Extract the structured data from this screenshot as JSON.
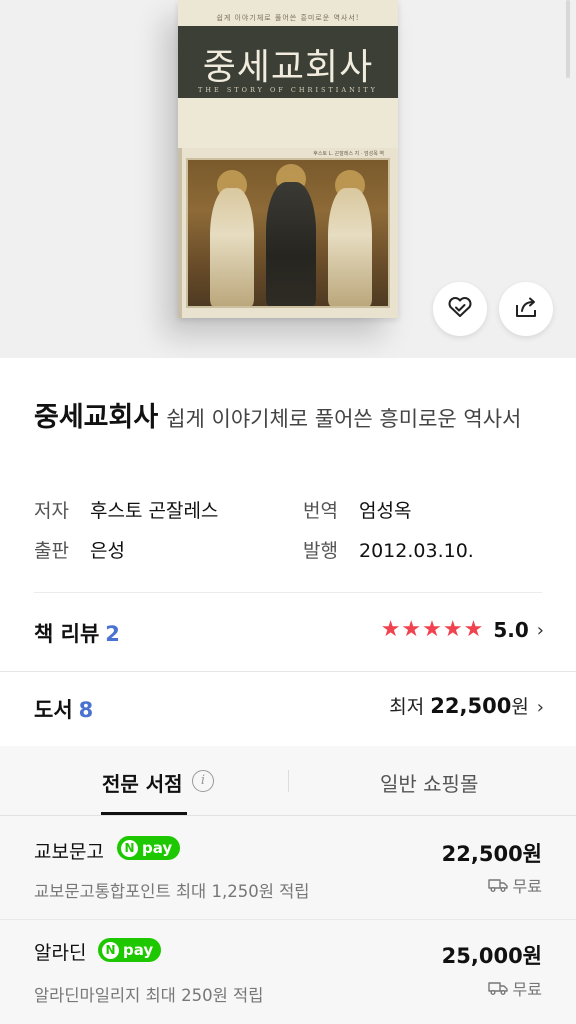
{
  "book_cover": {
    "title": "중세교회사",
    "subtitle_line": "쉽게 이야기체로 풀어쓴 흥미로운 역사서!",
    "english_title": "THE STORY OF CHRISTIANITY",
    "author_line": "후스토 L. 곤잘레스 지 · 엄성옥 역"
  },
  "actions": {
    "like_icon": "heart-check-icon",
    "share_icon": "share-icon"
  },
  "book": {
    "title": "중세교회사",
    "subtitle": "쉽게 이야기체로 풀어쓴 흥미로운 역사서"
  },
  "meta": {
    "author_label": "저자",
    "author": "후스토 곤잘레스",
    "translator_label": "번역",
    "translator": "엄성옥",
    "publisher_label": "출판",
    "publisher": "은성",
    "date_label": "발행",
    "date": "2012.03.10."
  },
  "review": {
    "label": "책 리뷰",
    "count": "2",
    "rating": "5.0",
    "stars": 5,
    "star_color": "#f0434f"
  },
  "books": {
    "label": "도서",
    "count": "8",
    "lowest_label": "최저",
    "lowest_price": "22,500",
    "currency": "원"
  },
  "tabs": {
    "active": "전문 서점",
    "inactive": "일반 쇼핑몰"
  },
  "stores": [
    {
      "name": "교보문고",
      "pay": "pay",
      "price": "22,500원",
      "point": "교보문고통합포인트 최대 1,250원 적립",
      "shipping": "무료"
    },
    {
      "name": "알라딘",
      "pay": "pay",
      "price": "25,000원",
      "point": "알라딘마일리지 최대 250원 적립",
      "shipping": "무료"
    }
  ],
  "colors": {
    "accent_blue": "#4a73d1",
    "npay_green": "#1ec800"
  }
}
